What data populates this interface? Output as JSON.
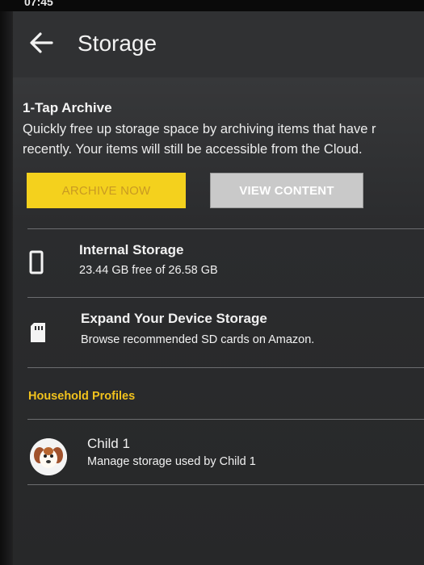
{
  "status_bar": {
    "time": "07:45"
  },
  "header": {
    "title": "Storage"
  },
  "archive": {
    "title": "1-Tap Archive",
    "description_line1": "Quickly free up storage space by archiving items that have r",
    "description_line2": "recently. Your items will still be accessible from the Cloud.",
    "archive_button": "ARCHIVE NOW",
    "view_button": "VIEW CONTENT"
  },
  "internal_storage": {
    "title": "Internal Storage",
    "detail": "23.44 GB free of 26.58 GB",
    "icon": "device-icon"
  },
  "expand_storage": {
    "title": "Expand Your Device Storage",
    "detail": "Browse recommended SD cards on Amazon.",
    "icon": "sd-card-icon"
  },
  "household": {
    "section_label": "Household Profiles",
    "profiles": [
      {
        "name": "Child 1",
        "detail": "Manage storage used by Child 1",
        "icon": "dog-avatar"
      }
    ]
  },
  "colors": {
    "accent_yellow": "#f4d11d",
    "section_label": "#f1c21d",
    "background": "#2a2b2d"
  }
}
